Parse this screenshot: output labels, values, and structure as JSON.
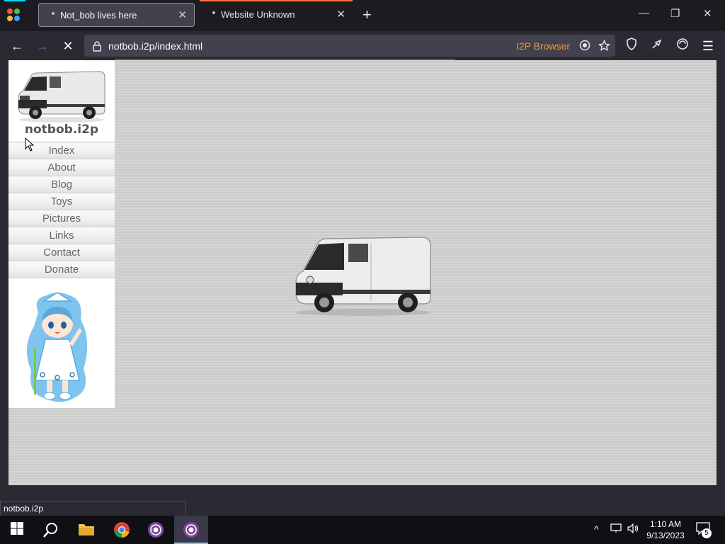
{
  "tabs": [
    {
      "title": "Not_bob lives here",
      "close": "✕"
    },
    {
      "title": "Website Unknown",
      "close": "✕"
    }
  ],
  "newtab_label": "+",
  "window_controls": {
    "minimize": "—",
    "restore": "❐",
    "close": "✕"
  },
  "nav": {
    "back": "←",
    "forward": "→",
    "stop": "✕",
    "menu": "☰"
  },
  "urlbar": {
    "url": "notbob.i2p/index.html",
    "i2p_label": "I2P Browser"
  },
  "site": {
    "title": "notbob.i2p",
    "menu": [
      "Index",
      "About",
      "Blog",
      "Toys",
      "Pictures",
      "Links",
      "Contact",
      "Donate"
    ]
  },
  "status_tip": "notbob.i2p",
  "taskbar": {
    "time": "1:10 AM",
    "date": "9/13/2023",
    "notification_count": "5"
  },
  "colors": {
    "loading_accent": "#ff6a2b",
    "i2p_label": "#e09b3a",
    "tab_accent": "#00ddff"
  }
}
